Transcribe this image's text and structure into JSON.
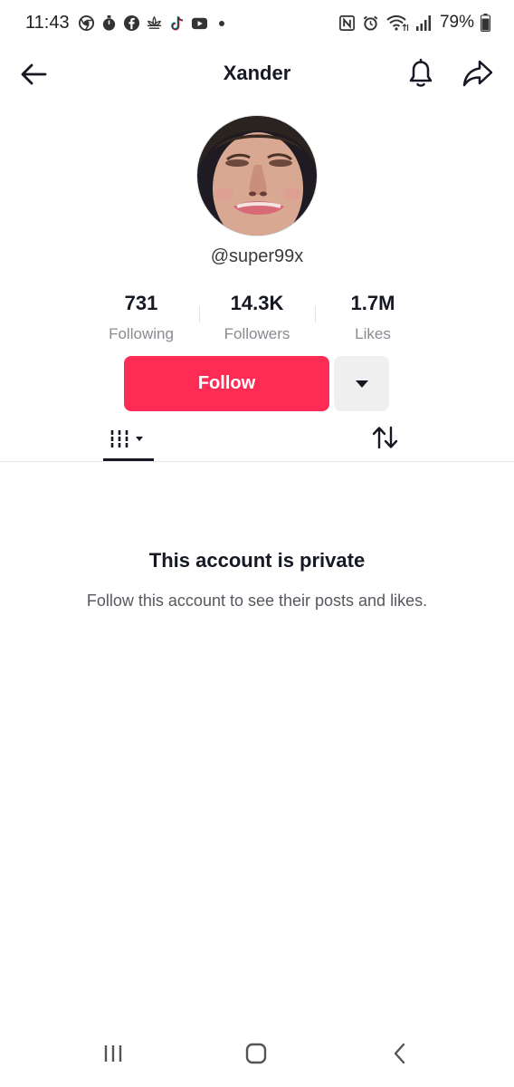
{
  "status_bar": {
    "time": "11:43",
    "battery": "79%",
    "left_icons": [
      "chrome-icon",
      "timer-icon",
      "facebook-icon",
      "lotus-icon",
      "tiktok-icon",
      "youtube-icon"
    ],
    "right_icons": [
      "nfc-icon",
      "alarm-icon",
      "wifi-icon",
      "signal-icon",
      "battery-icon"
    ]
  },
  "header": {
    "title": "Xander"
  },
  "profile": {
    "username": "@super99x",
    "stats": [
      {
        "value": "731",
        "label": "Following"
      },
      {
        "value": "14.3K",
        "label": "Followers"
      },
      {
        "value": "1.7M",
        "label": "Likes"
      }
    ]
  },
  "actions": {
    "follow_label": "Follow"
  },
  "private_notice": {
    "title": "This account is private",
    "subtitle": "Follow this account to see their posts and likes."
  },
  "colors": {
    "accent": "#fe2c55",
    "text": "#161823",
    "muted": "#8a8b91"
  }
}
